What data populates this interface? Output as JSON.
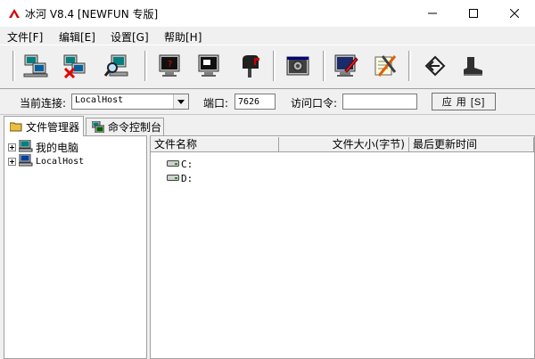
{
  "window": {
    "title": "冰河 V8.4 [NEWFUN 专版]",
    "controls": {
      "minimize": "minimize-icon",
      "maximize": "maximize-icon",
      "close": "close-icon"
    }
  },
  "menu": [
    {
      "label": "文件[F]"
    },
    {
      "label": "编辑[E]"
    },
    {
      "label": "设置[G]"
    },
    {
      "label": "帮助[H]"
    }
  ],
  "toolbar": {
    "icons": [
      "add-host-icon",
      "delete-host-icon",
      "search-host-icon",
      "screen-capture-icon",
      "screen-control-icon",
      "mailbox-icon",
      "config-icon",
      "edit-icon",
      "tools-icon",
      "back-icon",
      "exit-boot-icon"
    ]
  },
  "connection": {
    "current_label": "当前连接:",
    "current_value": "LocalHost",
    "port_label": "端口:",
    "port_value": "7626",
    "password_label": "访问口令:",
    "password_value": "",
    "apply_label": "应 用 [S]"
  },
  "tabs": [
    {
      "label": "文件管理器",
      "icon": "folder-icon",
      "active": true
    },
    {
      "label": "命令控制台",
      "icon": "console-icon",
      "active": false
    }
  ],
  "tree": {
    "items": [
      {
        "label": "我的电脑",
        "icon": "computer-icon"
      },
      {
        "label": "LocalHost",
        "icon": "computer-icon"
      }
    ]
  },
  "file_list": {
    "columns": [
      "文件名称",
      "文件大小(字节)",
      "最后更新时间"
    ],
    "rows": [
      {
        "name": "C:",
        "icon": "drive-icon"
      },
      {
        "name": "D:",
        "icon": "drive-icon"
      }
    ]
  },
  "colors": {
    "window_bg": "#f0f0f0",
    "pane_bg": "#ffffff",
    "accent_red": "#d40000"
  }
}
